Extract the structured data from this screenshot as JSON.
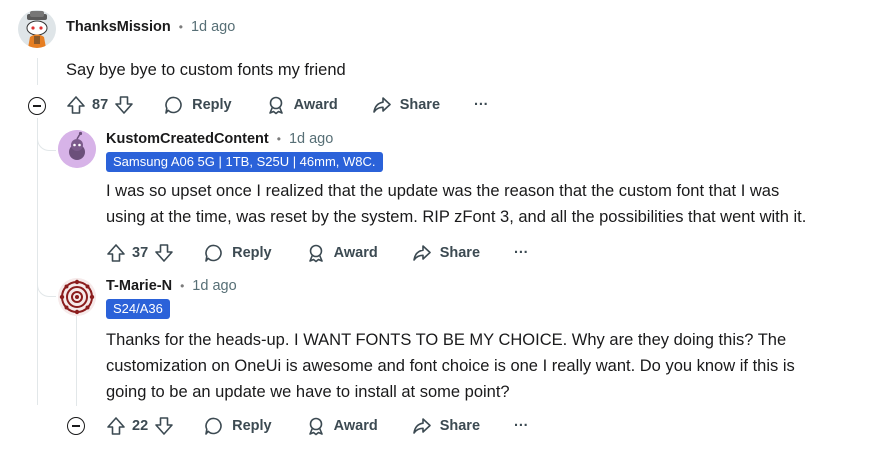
{
  "comments": [
    {
      "username": "ThanksMission",
      "separator": "•",
      "time": "1d ago",
      "body": "Say bye bye to custom fonts my friend",
      "votes": "87",
      "reply_label": "Reply",
      "award_label": "Award",
      "share_label": "Share",
      "more_label": "···"
    },
    {
      "username": "KustomCreatedContent",
      "separator": "•",
      "time": "1d ago",
      "flair": "Samsung A06 5G | 1TB, S25U | 46mm, W8C.",
      "body_lines": [
        "I was so upset once I realized that the update was the reason that the custom font that I was",
        "using at the time, was reset by the system. RIP zFont 3, and all the possibilities that went with it."
      ],
      "votes": "37",
      "reply_label": "Reply",
      "award_label": "Award",
      "share_label": "Share",
      "more_label": "···"
    },
    {
      "username": "T-Marie-N",
      "separator": "•",
      "time": "1d ago",
      "flair": "S24/A36",
      "body_lines": [
        "Thanks for the heads-up. I WANT FONTS TO BE MY CHOICE. Why are they doing this? The",
        "customization on OneUi is awesome and font choice is one I really want. Do you know if this is",
        "going to be an update we have to install at some point?"
      ],
      "votes": "22",
      "reply_label": "Reply",
      "award_label": "Award",
      "share_label": "Share",
      "more_label": "···"
    }
  ],
  "colors": {
    "flair_bg": "#2b62d9",
    "text": "#1a1a1b",
    "meta": "#576f76",
    "action": "#3c4a52"
  }
}
